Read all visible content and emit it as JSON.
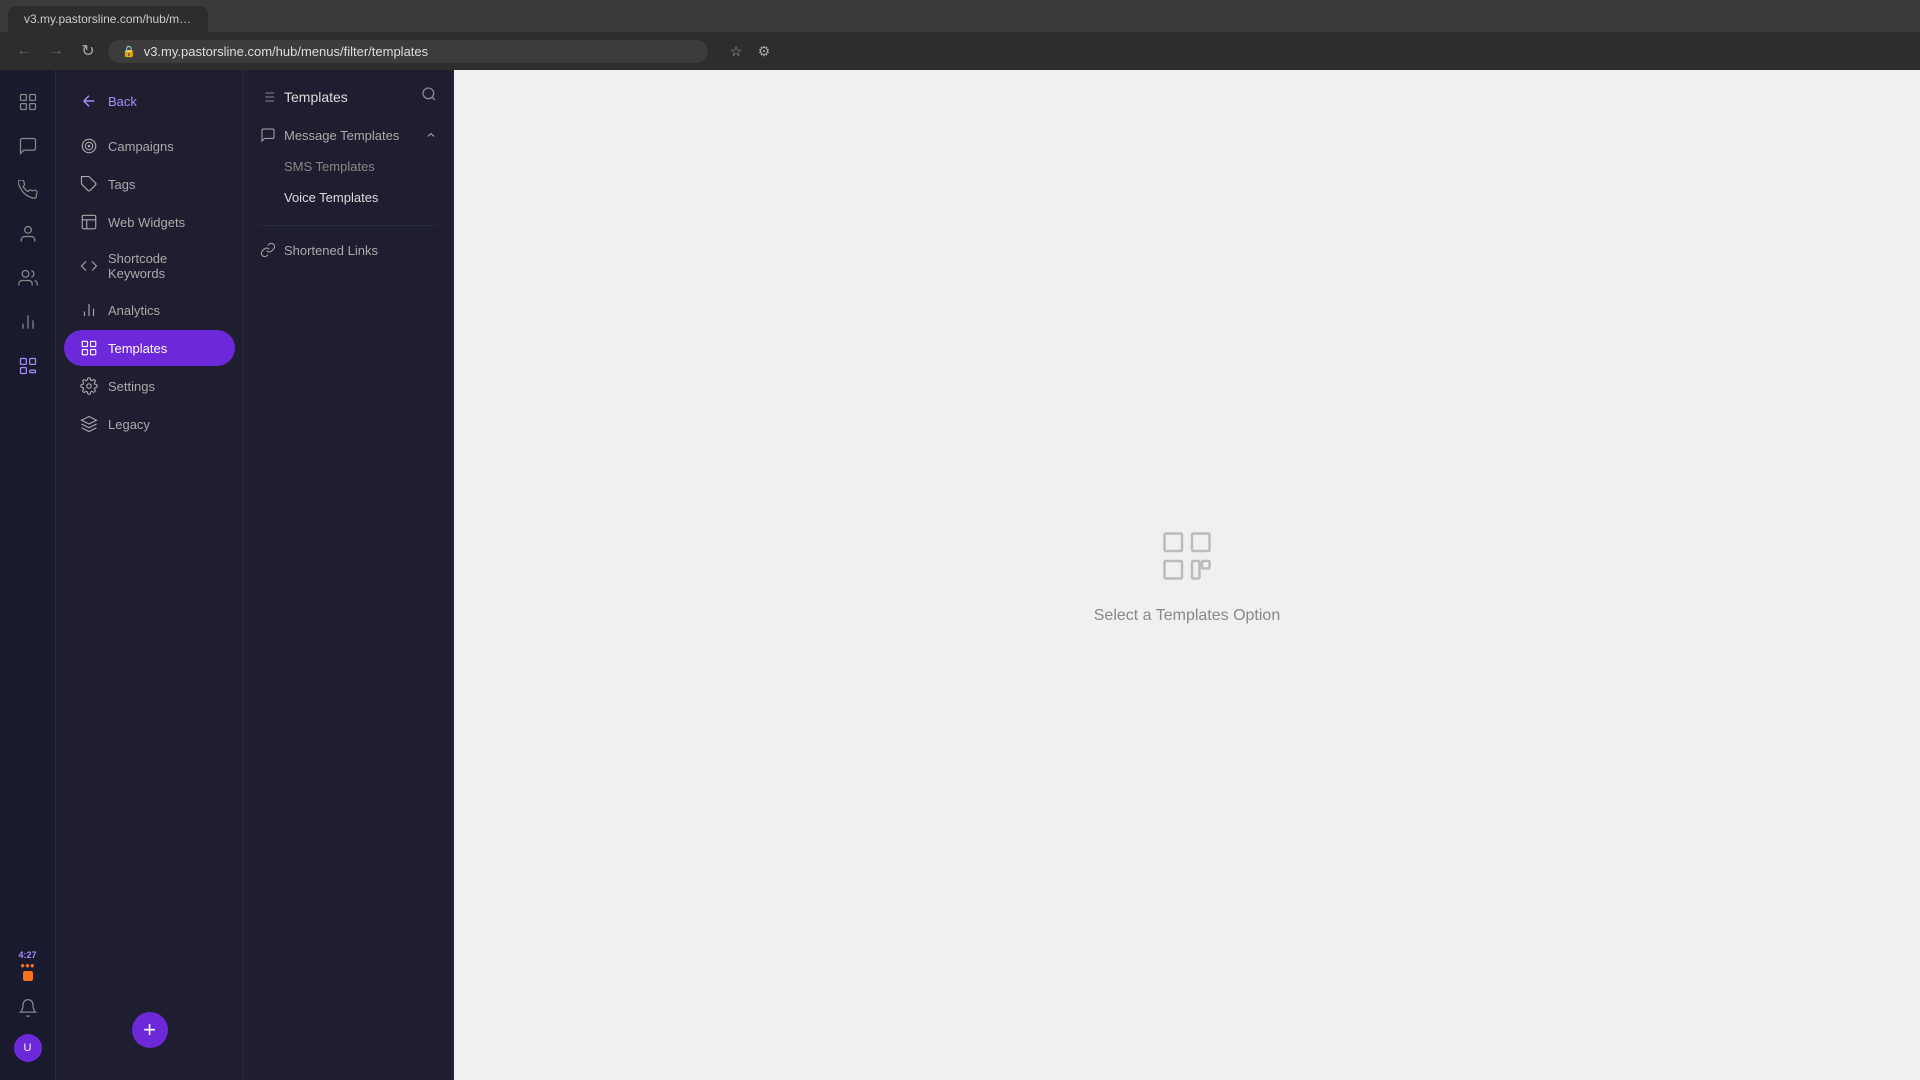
{
  "browser": {
    "tab_title": "v3.my.pastorsline.com/hub/menus/filter/templates",
    "address": "v3.my.pastorsline.com/hub/menus/filter/templates"
  },
  "icon_bar": {
    "items": [
      {
        "name": "grid-icon",
        "label": "Dashboard"
      },
      {
        "name": "chat-icon",
        "label": "Messages"
      },
      {
        "name": "phone-icon",
        "label": "Phone"
      },
      {
        "name": "person-icon",
        "label": "Contacts"
      },
      {
        "name": "group-icon",
        "label": "Groups"
      },
      {
        "name": "analytics-icon",
        "label": "Analytics"
      },
      {
        "name": "templates-icon",
        "label": "Templates"
      }
    ],
    "time": "4:27",
    "bottom_items": [
      {
        "name": "bell-icon",
        "label": "Notifications"
      },
      {
        "name": "avatar-icon",
        "label": "Profile"
      }
    ]
  },
  "nav_sidebar": {
    "back_label": "Back",
    "items": [
      {
        "id": "campaigns",
        "label": "Campaigns"
      },
      {
        "id": "tags",
        "label": "Tags"
      },
      {
        "id": "web-widgets",
        "label": "Web Widgets"
      },
      {
        "id": "shortcode-keywords",
        "label": "Shortcode Keywords"
      },
      {
        "id": "analytics",
        "label": "Analytics"
      },
      {
        "id": "templates",
        "label": "Templates",
        "active": true
      },
      {
        "id": "settings",
        "label": "Settings"
      },
      {
        "id": "legacy",
        "label": "Legacy"
      }
    ]
  },
  "templates_panel": {
    "title": "Templates",
    "message_templates_label": "Message Templates",
    "sms_templates_label": "SMS Templates",
    "voice_templates_label": "Voice Templates",
    "shortened_links_label": "Shortened Links"
  },
  "main": {
    "empty_state_text": "Select a Templates Option"
  }
}
